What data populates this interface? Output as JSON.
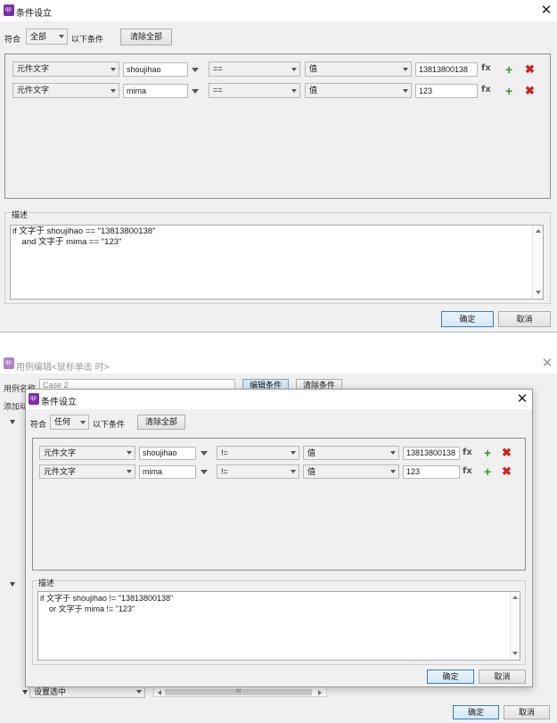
{
  "top": {
    "title": "条件设立",
    "match_label": "符合",
    "match_value": "全部",
    "match_suffix": "以下条件",
    "clear_all": "清除全部",
    "rows": [
      {
        "target_type": "元件文字",
        "target": "shoujihao",
        "operator": "==",
        "value_type": "值",
        "value": "13813800138"
      },
      {
        "target_type": "元件文字",
        "target": "mima",
        "operator": "==",
        "value_type": "值",
        "value": "123"
      }
    ],
    "fx": "fx",
    "description_label": "描述",
    "description": "if 文字于 shoujihao == \"13813800138\"\n    and 文字于 mima == \"123\"",
    "ok": "确定",
    "cancel": "取消"
  },
  "background": {
    "title": "用例编辑<鼠标单击 时>",
    "case_name_label": "用例名称",
    "case_name_value": "Case 2",
    "edit_conditions": "编辑条件",
    "clear_conditions": "清除条件",
    "add_label": "添加动",
    "set_selected": "设置选中",
    "scroll_marker": "III",
    "ok": "确定",
    "cancel": "取消"
  },
  "bottom": {
    "title": "条件设立",
    "match_label": "符合",
    "match_value": "任何",
    "match_suffix": "以下条件",
    "clear_all": "清除全部",
    "rows": [
      {
        "target_type": "元件文字",
        "target": "shoujihao",
        "operator": "!=",
        "value_type": "值",
        "value": "13813800138"
      },
      {
        "target_type": "元件文字",
        "target": "mima",
        "operator": "!=",
        "value_type": "值",
        "value": "123"
      }
    ],
    "fx": "fx",
    "description_label": "描述",
    "description": "if 文字于 shoujihao != \"13813800138\"\n    or 文字于 mima != \"123\"",
    "ok": "确定",
    "cancel": "取消"
  },
  "icons": {
    "app": "axure-app-icon",
    "close": "close-icon",
    "add": "add-condition-icon",
    "remove": "remove-condition-icon"
  },
  "colors": {
    "add_green": "#2f9a2f",
    "remove_red": "#d62020",
    "primary_border": "#3c7fb1"
  }
}
